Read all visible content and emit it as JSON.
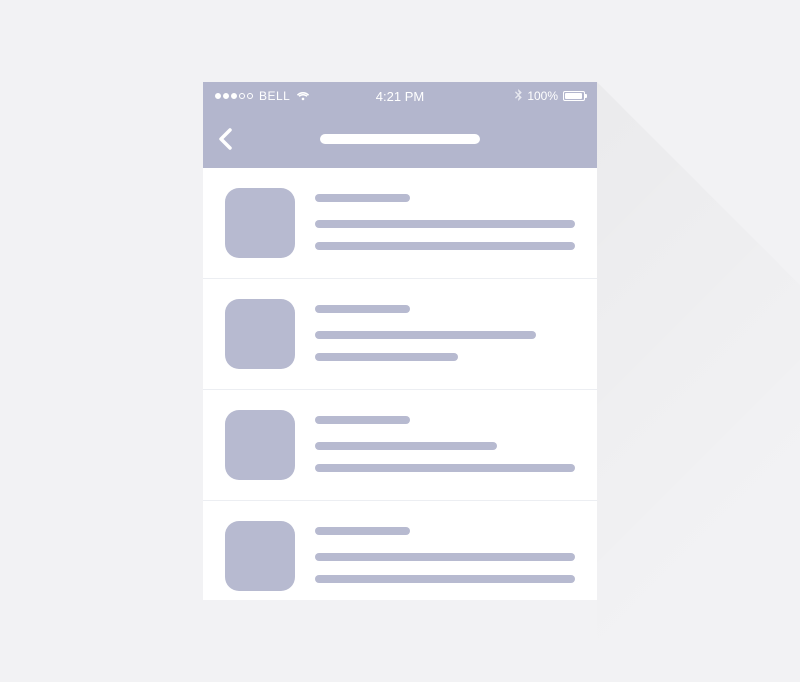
{
  "status_bar": {
    "carrier": "BELL",
    "time": "4:21 PM",
    "battery_pct": "100%"
  },
  "colors": {
    "header": "#b3b6cd",
    "placeholder": "#b7bad0",
    "bg": "#f2f2f4"
  }
}
